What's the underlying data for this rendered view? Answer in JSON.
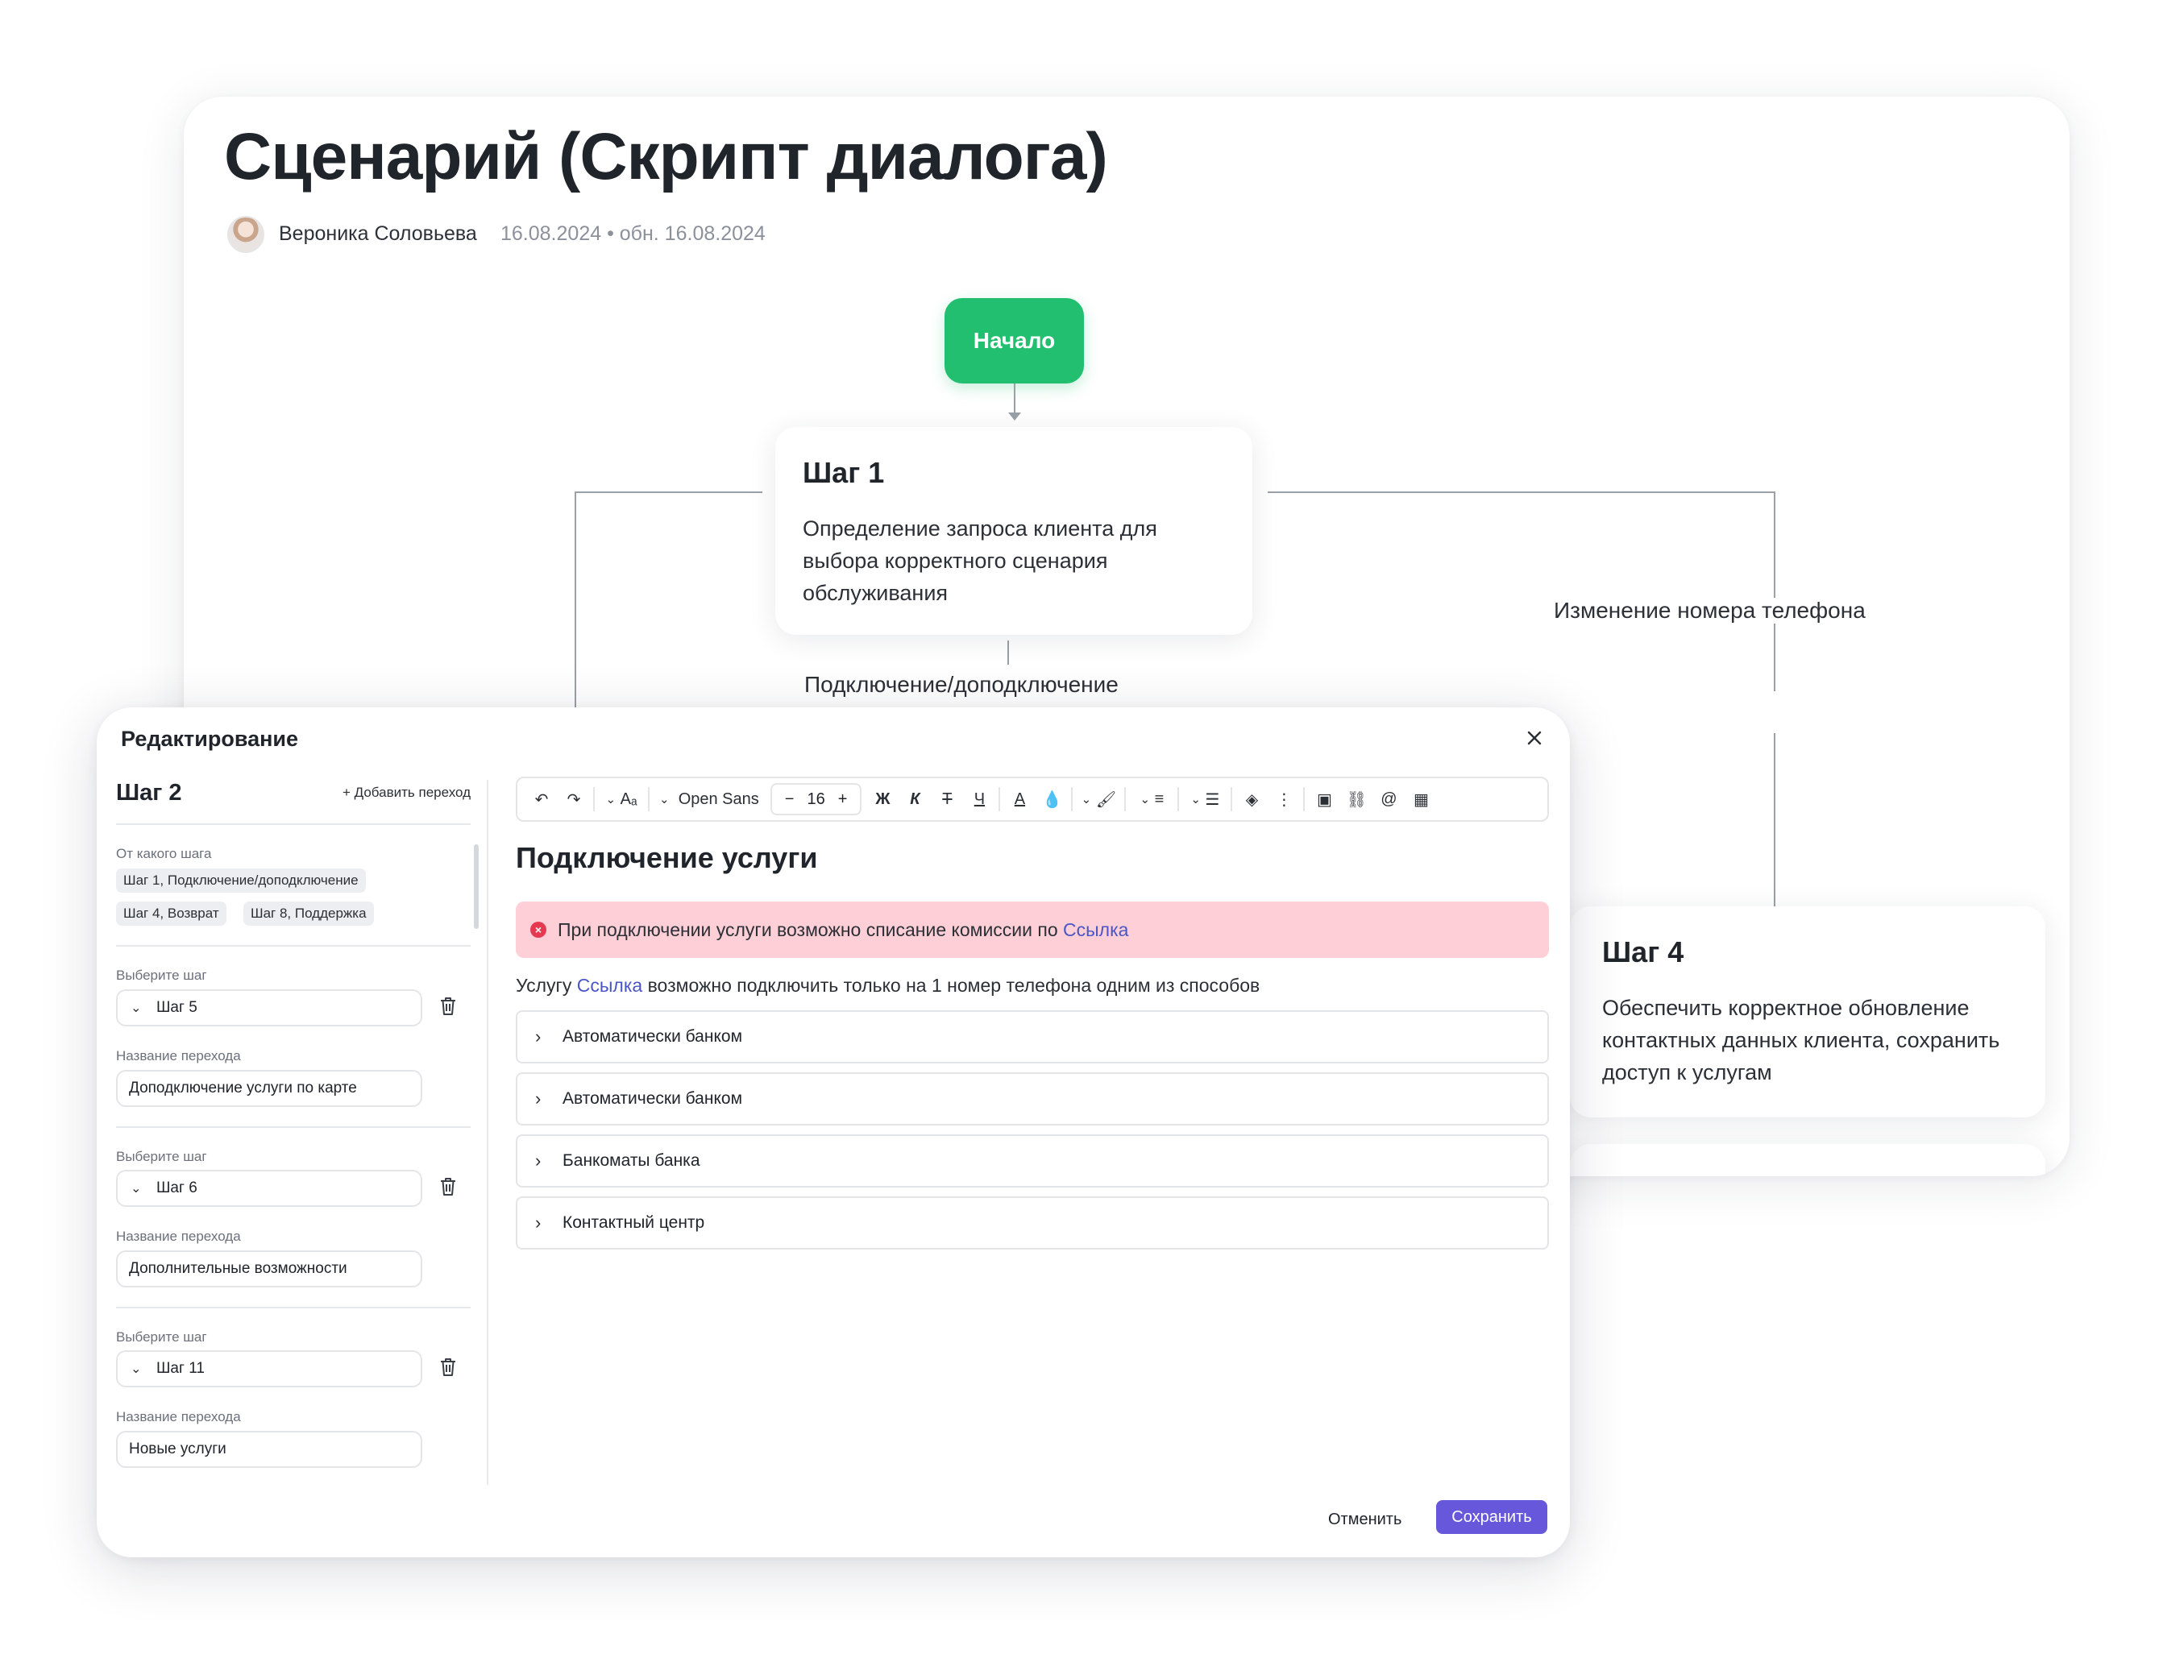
{
  "document": {
    "title": "Сценарий (Скрипт диалога)",
    "author": "Вероника Соловьева",
    "dates": "16.08.2024 • обн. 16.08.2024"
  },
  "flow": {
    "start_label": "Начало",
    "step1": {
      "title": "Шаг 1",
      "description": "Определение запроса клиента для выбора корректного сценария обслуживания"
    },
    "edge_connect": "Подключение/доподключение",
    "edge_phone": "Изменение номера телефона",
    "step4": {
      "title": "Шаг 4",
      "description": "Обеспечить корректное обновление контактных данных клиента, сохранить доступ к услугам"
    }
  },
  "modal": {
    "title": "Редактирование",
    "close_icon": "close-icon",
    "left": {
      "step_title": "Шаг 2",
      "add_transition": "Добавить переход",
      "from_label": "От какого шага",
      "from_chips": [
        "Шаг 1, Подключение/доподключение",
        "Шаг 4, Возврат",
        "Шаг 8, Поддержка"
      ],
      "transitions": [
        {
          "select_label": "Выберите шаг",
          "step": "Шаг 5",
          "name_label": "Название перехода",
          "name": "Доподключение услуги по карте"
        },
        {
          "select_label": "Выберите шаг",
          "step": "Шаг 6",
          "name_label": "Название перехода",
          "name": "Дополнительные возможности"
        },
        {
          "select_label": "Выберите шаг",
          "step": "Шаг 11",
          "name_label": "Название перехода",
          "name": "Новые услуги"
        }
      ]
    },
    "toolbar": {
      "font": "Open Sans",
      "size": "16",
      "bold": "Ж",
      "italic": "К",
      "strike": "Т",
      "underline": "Ч",
      "text_color": "A"
    },
    "editor": {
      "heading": "Подключение услуги",
      "alert_text": "При подключении услуги возможно списание комиссии по",
      "alert_link": "Ссылка",
      "para_before": "Услугу",
      "para_link": "Ссылка",
      "para_after": "возможно подключить только на 1 номер телефона одним из способов",
      "accordions": [
        "Автоматически банком",
        "Автоматически банком",
        "Банкоматы банка",
        "Контактный центр"
      ]
    },
    "cancel": "Отменить",
    "save": "Сохранить"
  },
  "colors": {
    "start_node": "#21bf6f",
    "save_button": "#6757db",
    "alert_bg": "#fecfd6",
    "alert_icon": "#e53950",
    "link": "#4a56c6"
  }
}
